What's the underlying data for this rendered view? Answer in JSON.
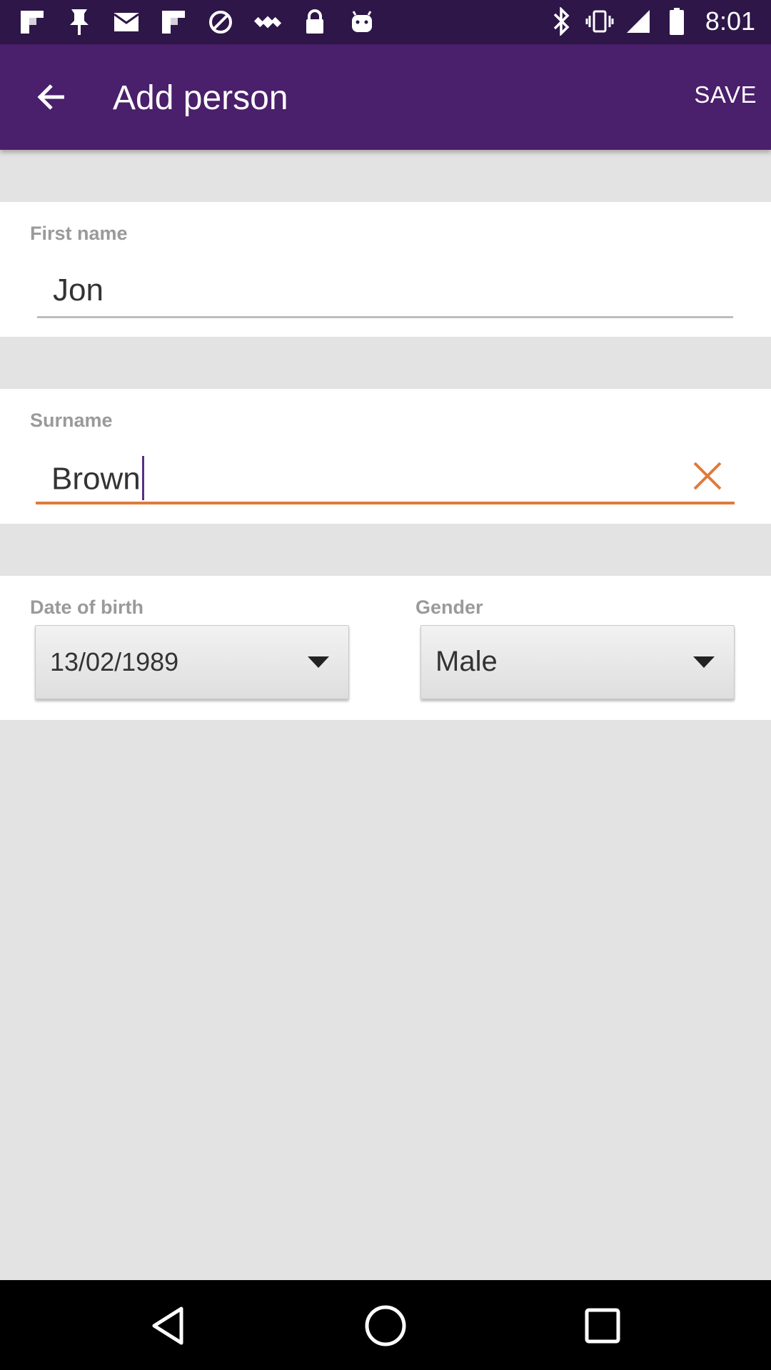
{
  "status_bar": {
    "time": "8:01",
    "left_icons": [
      "flipboard-icon",
      "notification-icon",
      "mail-icon",
      "flipboard-icon",
      "no-signal-icon",
      "satellite-icon",
      "lock-icon",
      "android-icon"
    ],
    "right_icons": [
      "bluetooth-icon",
      "vibrate-icon",
      "signal-icon",
      "battery-icon"
    ]
  },
  "app_bar": {
    "title": "Add person",
    "save_label": "SAVE"
  },
  "form": {
    "first_name": {
      "label": "First name",
      "value": "Jon"
    },
    "surname": {
      "label": "Surname",
      "value": "Brown"
    },
    "date_of_birth": {
      "label": "Date of birth",
      "value": "13/02/1989"
    },
    "gender": {
      "label": "Gender",
      "value": "Male"
    }
  },
  "navigation": {
    "back": "back-triangle-icon",
    "home": "home-circle-icon",
    "recents": "recents-square-icon"
  },
  "colors": {
    "status_bar": "#2e1648",
    "app_bar": "#4a1f6b",
    "accent": "#e07a3a",
    "background": "#e3e3e3"
  }
}
